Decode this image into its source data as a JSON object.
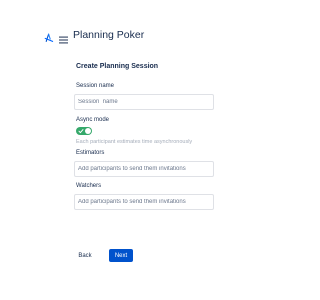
{
  "header": {
    "logo_icon": "planning-poker-logo",
    "menu_icon": "hamburger-menu-icon",
    "app_title": "Planning Poker"
  },
  "form": {
    "title": "Create Planning Session",
    "session_name": {
      "label": "Session name",
      "placeholder": "Session  name",
      "value": ""
    },
    "async_mode": {
      "label": "Async mode",
      "enabled": true,
      "helper": "Each participant estimates time asynchronously"
    },
    "estimators": {
      "label": "Estimators",
      "placeholder": "Add participants to send them invitations",
      "value": ""
    },
    "watchers": {
      "label": "Watchers",
      "placeholder": "Add participants to send them invitations",
      "value": ""
    }
  },
  "actions": {
    "back_label": "Back",
    "next_label": "Next"
  },
  "colors": {
    "accent": "#0052cc",
    "toggle_on": "#36a96b",
    "text": "#172b4d",
    "helper_text": "#a5adba",
    "input_border": "#dfe1e6"
  }
}
